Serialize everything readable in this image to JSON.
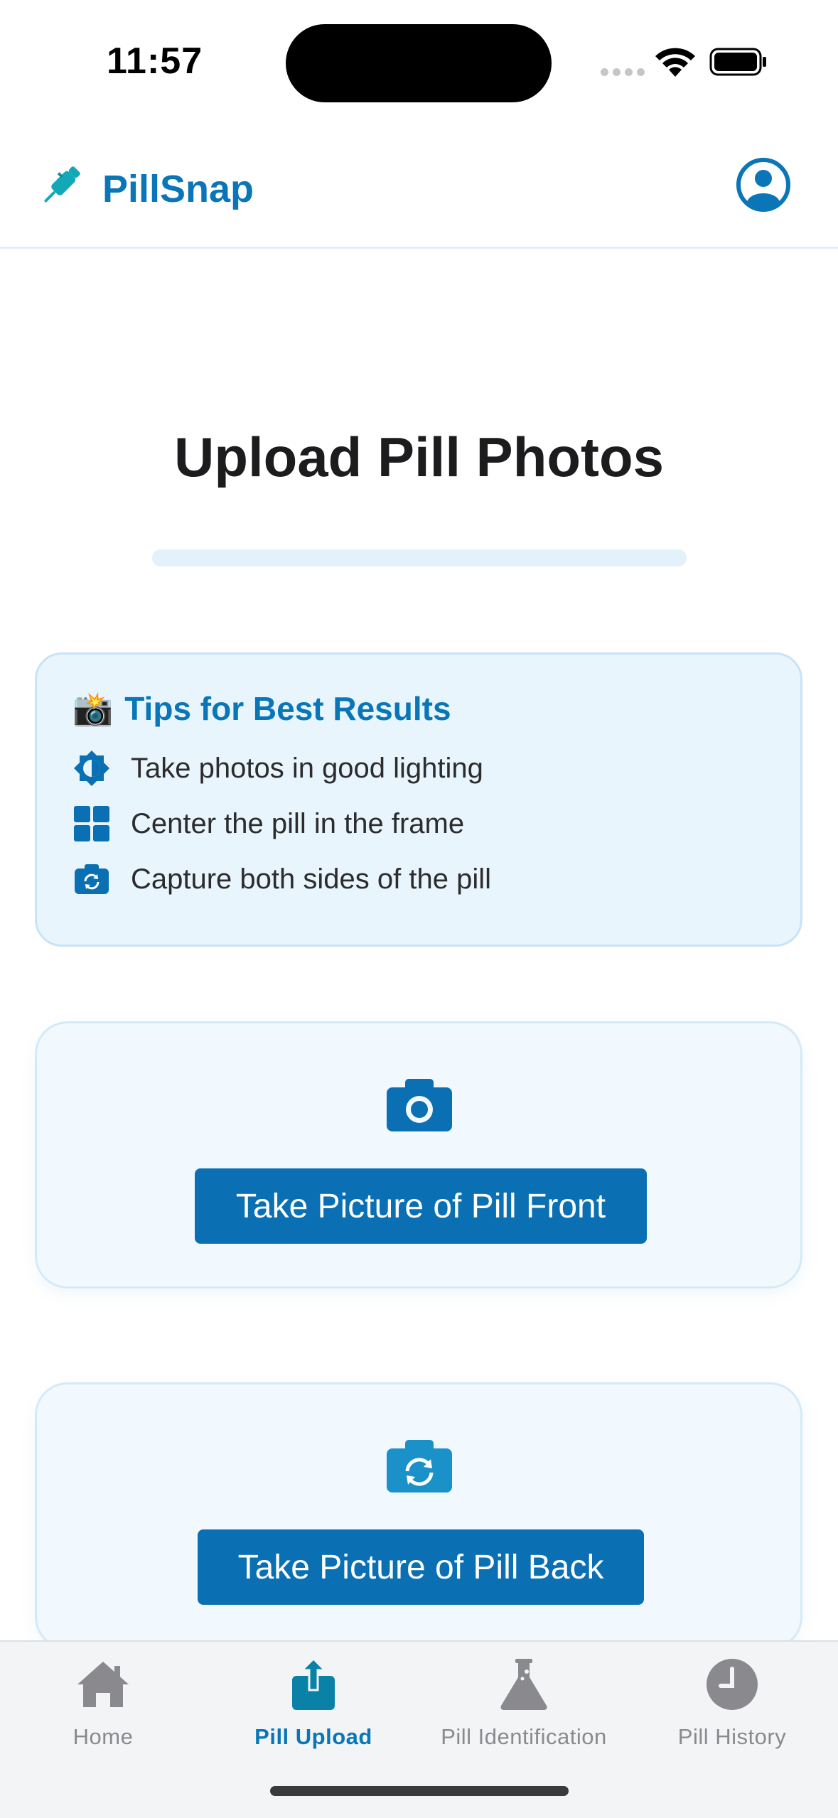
{
  "status_bar": {
    "time": "11:57"
  },
  "header": {
    "app_name": "PillSnap"
  },
  "main": {
    "title": "Upload Pill Photos",
    "progress": 0
  },
  "tips": {
    "emoji": "📸",
    "heading": "Tips for Best Results",
    "items": [
      {
        "icon": "brightness-icon",
        "text": "Take photos in good lighting"
      },
      {
        "icon": "grid-icon",
        "text": "Center the pill in the frame"
      },
      {
        "icon": "camera-flip-icon",
        "text": "Capture both sides of the pill"
      }
    ]
  },
  "front_card": {
    "icon": "camera-icon",
    "button_label": "Take Picture of Pill Front"
  },
  "back_card": {
    "icon": "camera-flip-icon",
    "button_label": "Take Picture of Pill Back"
  },
  "tab_bar": {
    "tabs": [
      {
        "icon": "home-icon",
        "label": "Home",
        "active": false
      },
      {
        "icon": "upload-icon",
        "label": "Pill Upload",
        "active": true
      },
      {
        "icon": "flask-icon",
        "label": "Pill Identification",
        "active": false
      },
      {
        "icon": "clock-icon",
        "label": "Pill History",
        "active": false
      }
    ]
  },
  "colors": {
    "brand": "#0a76b8",
    "button": "#0a70b3",
    "tips_background": "#e8f5fc",
    "card_background": "#f1f9fe",
    "inactive_tab": "#8a8a8e"
  }
}
